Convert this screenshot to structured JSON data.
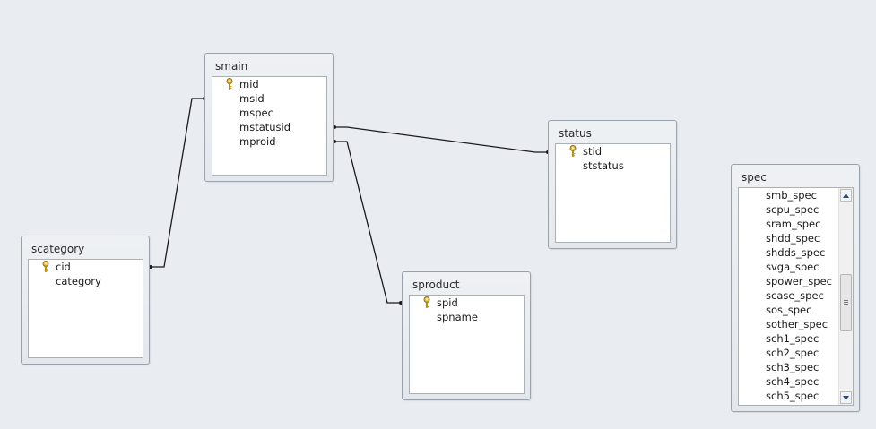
{
  "tables": {
    "smain": {
      "title": "smain",
      "fields": [
        {
          "name": "mid",
          "key": true
        },
        {
          "name": "msid",
          "key": false
        },
        {
          "name": "mspec",
          "key": false
        },
        {
          "name": "mstatusid",
          "key": false
        },
        {
          "name": "mproid",
          "key": false
        }
      ]
    },
    "status": {
      "title": "status",
      "fields": [
        {
          "name": "stid",
          "key": true
        },
        {
          "name": "ststatus",
          "key": false
        }
      ]
    },
    "scategory": {
      "title": "scategory",
      "fields": [
        {
          "name": "cid",
          "key": true
        },
        {
          "name": "category",
          "key": false
        }
      ]
    },
    "sproduct": {
      "title": "sproduct",
      "fields": [
        {
          "name": "spid",
          "key": true
        },
        {
          "name": "spname",
          "key": false
        }
      ]
    },
    "spec": {
      "title": "spec",
      "fields": [
        {
          "name": "smb_spec",
          "key": false
        },
        {
          "name": "scpu_spec",
          "key": false
        },
        {
          "name": "sram_spec",
          "key": false
        },
        {
          "name": "shdd_spec",
          "key": false
        },
        {
          "name": "shdds_spec",
          "key": false
        },
        {
          "name": "svga_spec",
          "key": false
        },
        {
          "name": "spower_spec",
          "key": false
        },
        {
          "name": "scase_spec",
          "key": false
        },
        {
          "name": "sos_spec",
          "key": false
        },
        {
          "name": "sother_spec",
          "key": false
        },
        {
          "name": "sch1_spec",
          "key": false
        },
        {
          "name": "sch2_spec",
          "key": false
        },
        {
          "name": "sch3_spec",
          "key": false
        },
        {
          "name": "sch4_spec",
          "key": false
        },
        {
          "name": "sch5_spec",
          "key": false
        }
      ]
    }
  },
  "relationships": [
    {
      "from": "smain.msid",
      "to": "scategory.cid"
    },
    {
      "from": "smain.mstatusid",
      "to": "status.stid"
    },
    {
      "from": "smain.mproid",
      "to": "sproduct.spid"
    }
  ],
  "icons": {
    "key": "key-icon",
    "scroll_up": "arrow-up-icon",
    "scroll_down": "arrow-down-icon"
  },
  "colors": {
    "canvas": "#e9edf1",
    "key_gold": "#d4a820",
    "line": "#1a1a1a"
  }
}
